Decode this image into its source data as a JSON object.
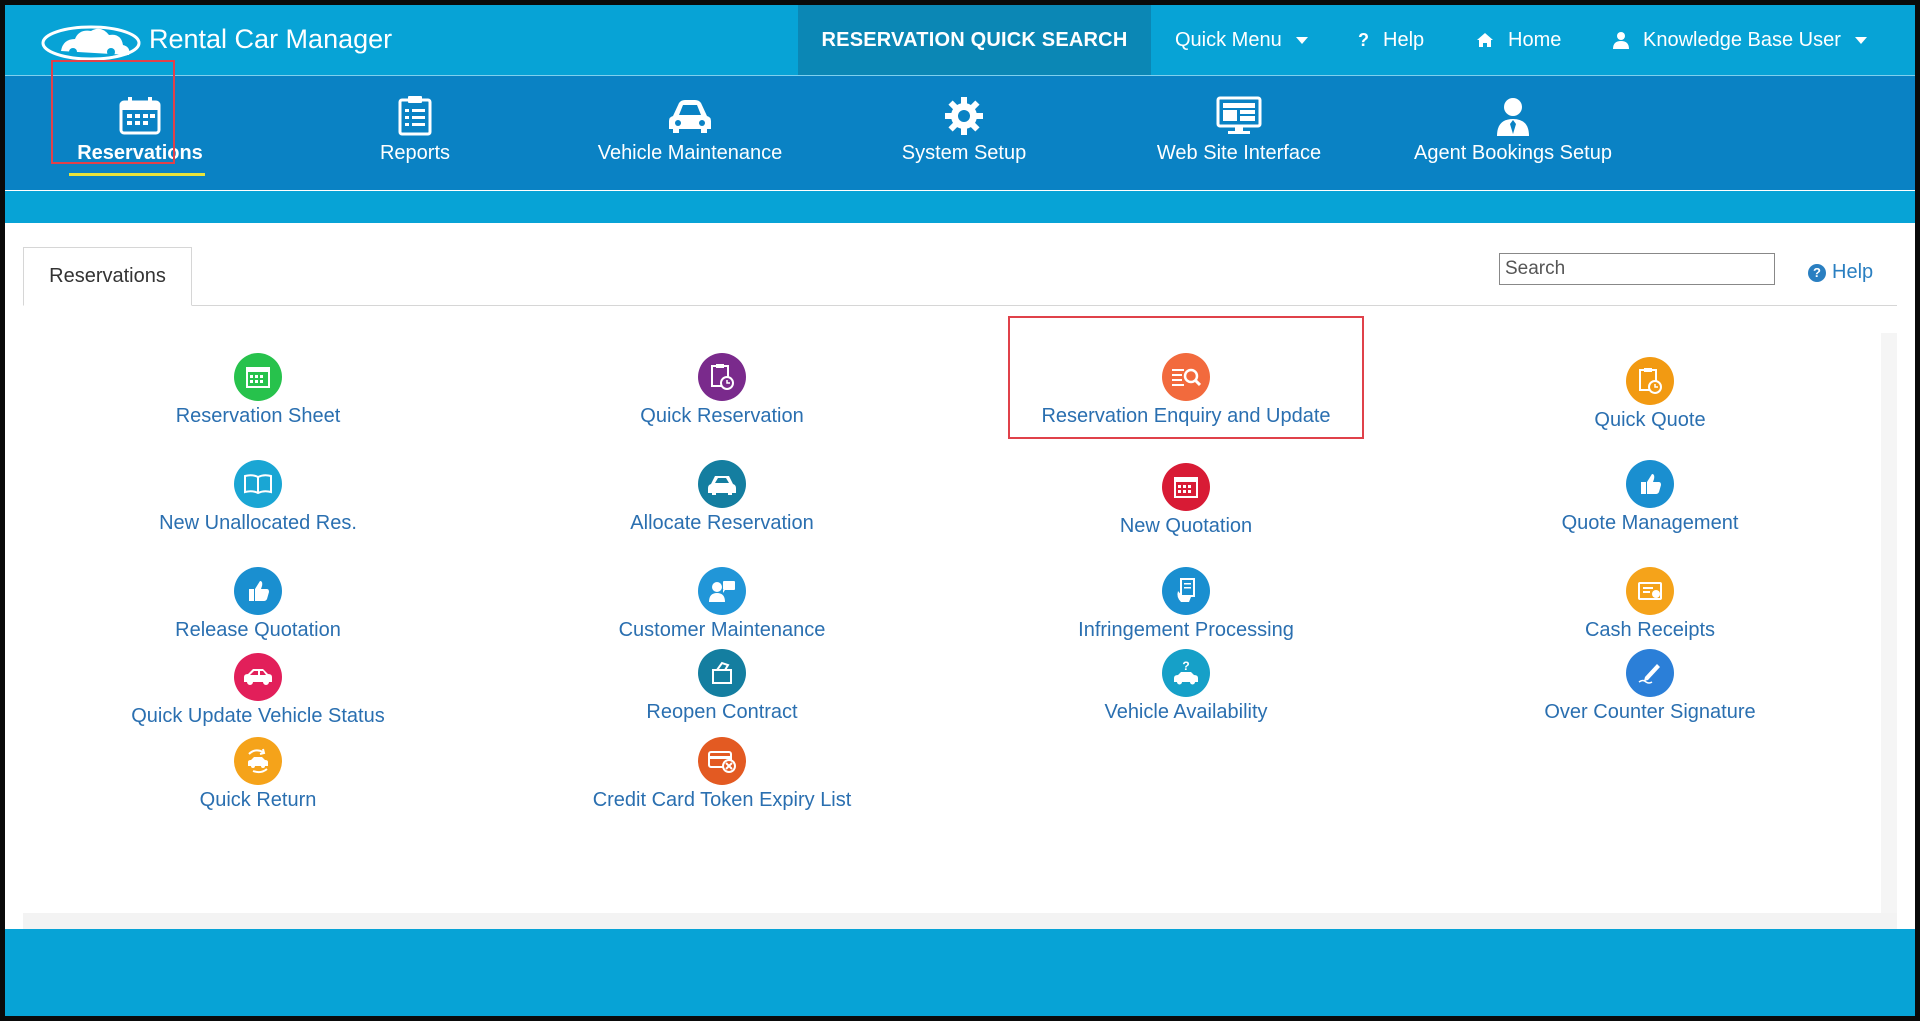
{
  "app": {
    "title": "Rental Car Manager"
  },
  "topbar": {
    "quick_search": "RESERVATION QUICK SEARCH",
    "quick_menu": "Quick Menu",
    "help": "Help",
    "home": "Home",
    "user": "Knowledge Base User"
  },
  "modules": [
    {
      "label": "Reservations",
      "icon": "calendar-icon"
    },
    {
      "label": "Reports",
      "icon": "clipboard-list-icon"
    },
    {
      "label": "Vehicle Maintenance",
      "icon": "car-icon"
    },
    {
      "label": "System Setup",
      "icon": "gear-icon"
    },
    {
      "label": "Web Site Interface",
      "icon": "monitor-icon"
    },
    {
      "label": "Agent Bookings Setup",
      "icon": "agent-icon"
    }
  ],
  "panel": {
    "tab": "Reservations",
    "search_placeholder": "Search",
    "help": "Help"
  },
  "items": [
    {
      "label": "Reservation Sheet",
      "icon": "calendar-icon",
      "color": "#27c24c"
    },
    {
      "label": "Quick Reservation",
      "icon": "clipboard-clock-icon",
      "color": "#7a2a8c"
    },
    {
      "label": "Reservation Enquiry and Update",
      "icon": "list-search-icon",
      "color": "#f26a3d"
    },
    {
      "label": "Quick Quote",
      "icon": "clipboard-clock-icon",
      "color": "#f29a12"
    },
    {
      "label": "New Unallocated Res.",
      "icon": "book-icon",
      "color": "#1aa6d4"
    },
    {
      "label": "Allocate Reservation",
      "icon": "car-icon",
      "color": "#147ea0"
    },
    {
      "label": "New Quotation",
      "icon": "calendar-icon",
      "color": "#d81b35"
    },
    {
      "label": "Quote Management",
      "icon": "thumbs-up-icon",
      "color": "#1a8fd0"
    },
    {
      "label": "Release Quotation",
      "icon": "thumbs-up-icon",
      "color": "#1a8fd0"
    },
    {
      "label": "Customer Maintenance",
      "icon": "customer-icon",
      "color": "#2196d8"
    },
    {
      "label": "Infringement Processing",
      "icon": "phone-document-icon",
      "color": "#1a8fd0"
    },
    {
      "label": "Cash Receipts",
      "icon": "receipt-icon",
      "color": "#f5a31a"
    },
    {
      "label": "Quick Update Vehicle Status",
      "icon": "car-icon",
      "color": "#e21f5a"
    },
    {
      "label": "Reopen Contract",
      "icon": "folder-open-icon",
      "color": "#147ea0"
    },
    {
      "label": "Vehicle Availability",
      "icon": "car-question-icon",
      "color": "#16a0c8"
    },
    {
      "label": "Over Counter Signature",
      "icon": "pen-icon",
      "color": "#2b7fd8"
    },
    {
      "label": "Quick Return",
      "icon": "car-return-icon",
      "color": "#f5a31a"
    },
    {
      "label": "Credit Card Token Expiry List",
      "icon": "credit-card-x-icon",
      "color": "#e35a22"
    }
  ]
}
